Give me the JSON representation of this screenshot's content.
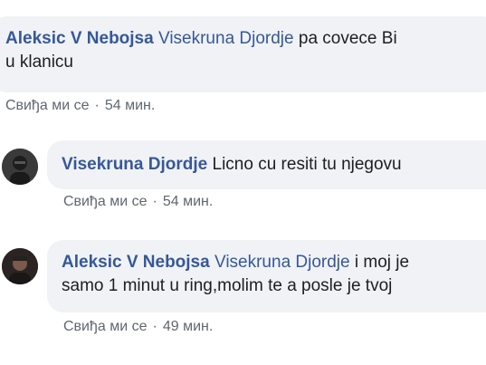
{
  "comments": [
    {
      "author": "Aleksic V Nebojsa",
      "mention": "Visekruna Djordje",
      "line1_text": " pa covece Bi",
      "line2_text": "u klanicu",
      "like_label": "Свиђа ми се",
      "separator": "·",
      "time": "54 мин."
    },
    {
      "author": "Visekruna Djordje",
      "text": " Licno cu resiti tu njegovu",
      "like_label": "Свиђа ми се",
      "separator": "·",
      "time": "54 мин."
    },
    {
      "author": "Aleksic V Nebojsa",
      "mention": "Visekruna Djordje",
      "line1_text": " i moj je",
      "line2_text": "samo 1 minut u ring,molim te a posle je tvoj",
      "like_label": "Свиђа ми се",
      "separator": "·",
      "time": "49 мин."
    }
  ],
  "colors": {
    "bubble_bg": "#f0f2f5",
    "author": "#365899",
    "meta": "#606770"
  }
}
